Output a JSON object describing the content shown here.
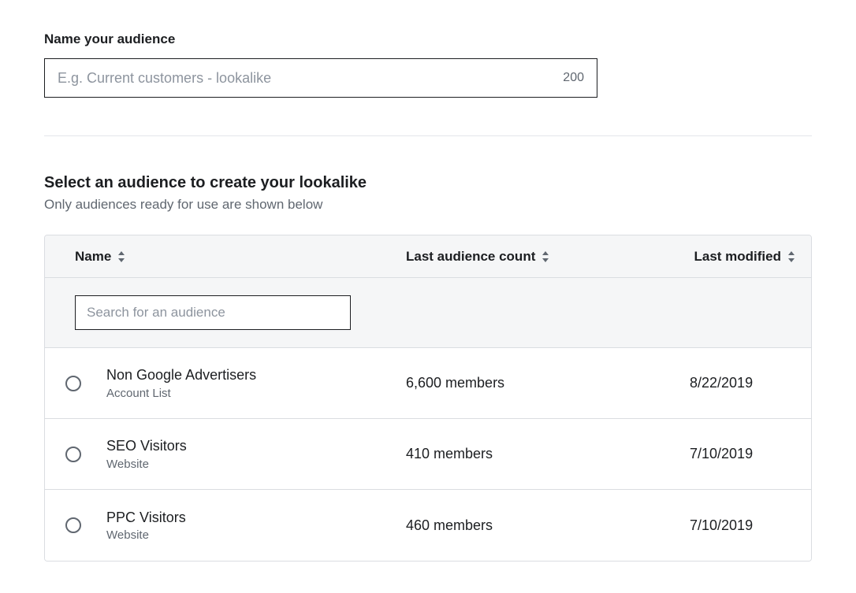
{
  "name_section": {
    "label": "Name your audience",
    "placeholder": "E.g. Current customers - lookalike",
    "char_limit": "200"
  },
  "select_section": {
    "heading": "Select an audience to create your lookalike",
    "subheading": "Only audiences ready for use are shown below"
  },
  "table": {
    "headers": {
      "name": "Name",
      "count": "Last audience count",
      "modified": "Last modified"
    },
    "search_placeholder": "Search for an audience",
    "rows": [
      {
        "name": "Non Google Advertisers",
        "type": "Account List",
        "count": "6,600 members",
        "modified": "8/22/2019"
      },
      {
        "name": "SEO Visitors",
        "type": "Website",
        "count": "410 members",
        "modified": "7/10/2019"
      },
      {
        "name": "PPC Visitors",
        "type": "Website",
        "count": "460 members",
        "modified": "7/10/2019"
      }
    ]
  }
}
